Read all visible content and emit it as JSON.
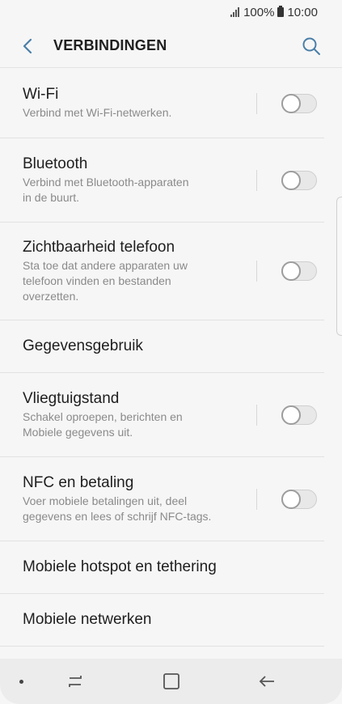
{
  "status_bar": {
    "battery": "100%",
    "time": "10:00"
  },
  "app_bar": {
    "title": "VERBINDINGEN"
  },
  "items": [
    {
      "title": "Wi-Fi",
      "subtitle": "Verbind met Wi-Fi-netwerken.",
      "toggle": false
    },
    {
      "title": "Bluetooth",
      "subtitle": "Verbind met Bluetooth-apparaten\nin de buurt.",
      "toggle": false
    },
    {
      "title": "Zichtbaarheid telefoon",
      "subtitle": "Sta toe dat andere apparaten uw\ntelefoon vinden en bestanden\noverzetten.",
      "toggle": false
    },
    {
      "title": "Gegevensgebruik"
    },
    {
      "title": "Vliegtuigstand",
      "subtitle": "Schakel oproepen, berichten en\nMobiele gegevens uit.",
      "toggle": false
    },
    {
      "title": "NFC en betaling",
      "subtitle": "Voer mobiele betalingen uit, deel\ngegevens en lees of schrijf NFC-tags.",
      "toggle": false
    },
    {
      "title": "Mobiele hotspot en tethering"
    },
    {
      "title": "Mobiele netwerken"
    }
  ],
  "colors": {
    "accent": "#4a7fa8",
    "background": "#f6f6f6",
    "nav_bar": "#ececec"
  },
  "icons": {
    "back": "arrow-left-icon",
    "search": "search-icon",
    "nav_recent": "recent-apps-icon",
    "nav_home": "home-icon",
    "nav_back": "back-arrow-icon"
  }
}
